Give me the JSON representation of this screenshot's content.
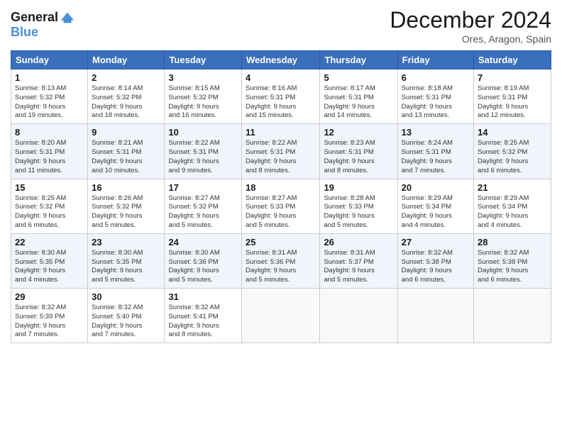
{
  "logo": {
    "line1": "General",
    "line2": "Blue"
  },
  "header": {
    "month": "December 2024",
    "location": "Ores, Aragon, Spain"
  },
  "weekdays": [
    "Sunday",
    "Monday",
    "Tuesday",
    "Wednesday",
    "Thursday",
    "Friday",
    "Saturday"
  ],
  "weeks": [
    [
      {
        "day": "1",
        "info": "Sunrise: 8:13 AM\nSunset: 5:32 PM\nDaylight: 9 hours\nand 19 minutes."
      },
      {
        "day": "2",
        "info": "Sunrise: 8:14 AM\nSunset: 5:32 PM\nDaylight: 9 hours\nand 18 minutes."
      },
      {
        "day": "3",
        "info": "Sunrise: 8:15 AM\nSunset: 5:32 PM\nDaylight: 9 hours\nand 16 minutes."
      },
      {
        "day": "4",
        "info": "Sunrise: 8:16 AM\nSunset: 5:31 PM\nDaylight: 9 hours\nand 15 minutes."
      },
      {
        "day": "5",
        "info": "Sunrise: 8:17 AM\nSunset: 5:31 PM\nDaylight: 9 hours\nand 14 minutes."
      },
      {
        "day": "6",
        "info": "Sunrise: 8:18 AM\nSunset: 5:31 PM\nDaylight: 9 hours\nand 13 minutes."
      },
      {
        "day": "7",
        "info": "Sunrise: 8:19 AM\nSunset: 5:31 PM\nDaylight: 9 hours\nand 12 minutes."
      }
    ],
    [
      {
        "day": "8",
        "info": "Sunrise: 8:20 AM\nSunset: 5:31 PM\nDaylight: 9 hours\nand 11 minutes."
      },
      {
        "day": "9",
        "info": "Sunrise: 8:21 AM\nSunset: 5:31 PM\nDaylight: 9 hours\nand 10 minutes."
      },
      {
        "day": "10",
        "info": "Sunrise: 8:22 AM\nSunset: 5:31 PM\nDaylight: 9 hours\nand 9 minutes."
      },
      {
        "day": "11",
        "info": "Sunrise: 8:22 AM\nSunset: 5:31 PM\nDaylight: 9 hours\nand 8 minutes."
      },
      {
        "day": "12",
        "info": "Sunrise: 8:23 AM\nSunset: 5:31 PM\nDaylight: 9 hours\nand 8 minutes."
      },
      {
        "day": "13",
        "info": "Sunrise: 8:24 AM\nSunset: 5:31 PM\nDaylight: 9 hours\nand 7 minutes."
      },
      {
        "day": "14",
        "info": "Sunrise: 8:25 AM\nSunset: 5:32 PM\nDaylight: 9 hours\nand 6 minutes."
      }
    ],
    [
      {
        "day": "15",
        "info": "Sunrise: 8:25 AM\nSunset: 5:32 PM\nDaylight: 9 hours\nand 6 minutes."
      },
      {
        "day": "16",
        "info": "Sunrise: 8:26 AM\nSunset: 5:32 PM\nDaylight: 9 hours\nand 5 minutes."
      },
      {
        "day": "17",
        "info": "Sunrise: 8:27 AM\nSunset: 5:32 PM\nDaylight: 9 hours\nand 5 minutes."
      },
      {
        "day": "18",
        "info": "Sunrise: 8:27 AM\nSunset: 5:33 PM\nDaylight: 9 hours\nand 5 minutes."
      },
      {
        "day": "19",
        "info": "Sunrise: 8:28 AM\nSunset: 5:33 PM\nDaylight: 9 hours\nand 5 minutes."
      },
      {
        "day": "20",
        "info": "Sunrise: 8:29 AM\nSunset: 5:34 PM\nDaylight: 9 hours\nand 4 minutes."
      },
      {
        "day": "21",
        "info": "Sunrise: 8:29 AM\nSunset: 5:34 PM\nDaylight: 9 hours\nand 4 minutes."
      }
    ],
    [
      {
        "day": "22",
        "info": "Sunrise: 8:30 AM\nSunset: 5:35 PM\nDaylight: 9 hours\nand 4 minutes."
      },
      {
        "day": "23",
        "info": "Sunrise: 8:30 AM\nSunset: 5:35 PM\nDaylight: 9 hours\nand 5 minutes."
      },
      {
        "day": "24",
        "info": "Sunrise: 8:30 AM\nSunset: 5:36 PM\nDaylight: 9 hours\nand 5 minutes."
      },
      {
        "day": "25",
        "info": "Sunrise: 8:31 AM\nSunset: 5:36 PM\nDaylight: 9 hours\nand 5 minutes."
      },
      {
        "day": "26",
        "info": "Sunrise: 8:31 AM\nSunset: 5:37 PM\nDaylight: 9 hours\nand 5 minutes."
      },
      {
        "day": "27",
        "info": "Sunrise: 8:32 AM\nSunset: 5:38 PM\nDaylight: 9 hours\nand 6 minutes."
      },
      {
        "day": "28",
        "info": "Sunrise: 8:32 AM\nSunset: 5:38 PM\nDaylight: 9 hours\nand 6 minutes."
      }
    ],
    [
      {
        "day": "29",
        "info": "Sunrise: 8:32 AM\nSunset: 5:39 PM\nDaylight: 9 hours\nand 7 minutes."
      },
      {
        "day": "30",
        "info": "Sunrise: 8:32 AM\nSunset: 5:40 PM\nDaylight: 9 hours\nand 7 minutes."
      },
      {
        "day": "31",
        "info": "Sunrise: 8:32 AM\nSunset: 5:41 PM\nDaylight: 9 hours\nand 8 minutes."
      },
      null,
      null,
      null,
      null
    ]
  ]
}
